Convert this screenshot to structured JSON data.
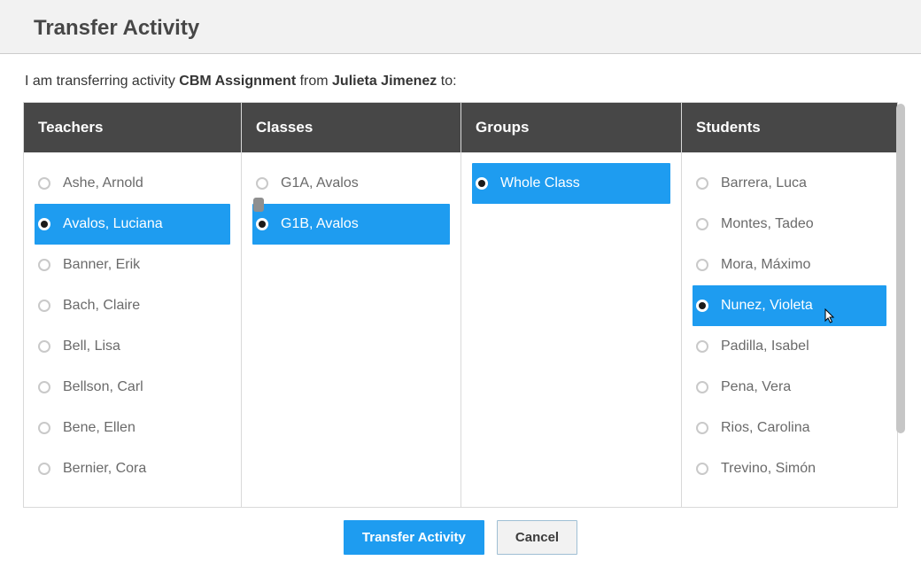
{
  "header": {
    "title": "Transfer Activity"
  },
  "subhead": {
    "prefix": "I am transferring activity ",
    "activity_name": "CBM Assignment",
    "mid": " from ",
    "from_name": "Julieta Jimenez",
    "suffix": " to:"
  },
  "columns": {
    "teachers": {
      "title": "Teachers",
      "items": [
        {
          "label": "Ashe, Arnold",
          "selected": false
        },
        {
          "label": "Avalos, Luciana",
          "selected": true
        },
        {
          "label": "Banner, Erik",
          "selected": false
        },
        {
          "label": "Bach, Claire",
          "selected": false
        },
        {
          "label": "Bell, Lisa",
          "selected": false
        },
        {
          "label": "Bellson, Carl",
          "selected": false
        },
        {
          "label": "Bene, Ellen",
          "selected": false
        },
        {
          "label": "Bernier, Cora",
          "selected": false
        }
      ]
    },
    "classes": {
      "title": "Classes",
      "items": [
        {
          "label": "G1A, Avalos",
          "selected": false
        },
        {
          "label": "G1B, Avalos",
          "selected": true
        }
      ]
    },
    "groups": {
      "title": "Groups",
      "items": [
        {
          "label": "Whole Class",
          "selected": true
        }
      ]
    },
    "students": {
      "title": "Students",
      "items": [
        {
          "label": "Barrera, Luca",
          "selected": false
        },
        {
          "label": "Montes, Tadeo",
          "selected": false
        },
        {
          "label": "Mora, Máximo",
          "selected": false
        },
        {
          "label": "Nunez, Violeta",
          "selected": true
        },
        {
          "label": "Padilla, Isabel",
          "selected": false
        },
        {
          "label": "Pena, Vera",
          "selected": false
        },
        {
          "label": "Rios, Carolina",
          "selected": false
        },
        {
          "label": "Trevino, Simón",
          "selected": false
        }
      ],
      "cursor_on_index": 3
    }
  },
  "footer": {
    "primary_label": "Transfer Activity",
    "cancel_label": "Cancel"
  }
}
